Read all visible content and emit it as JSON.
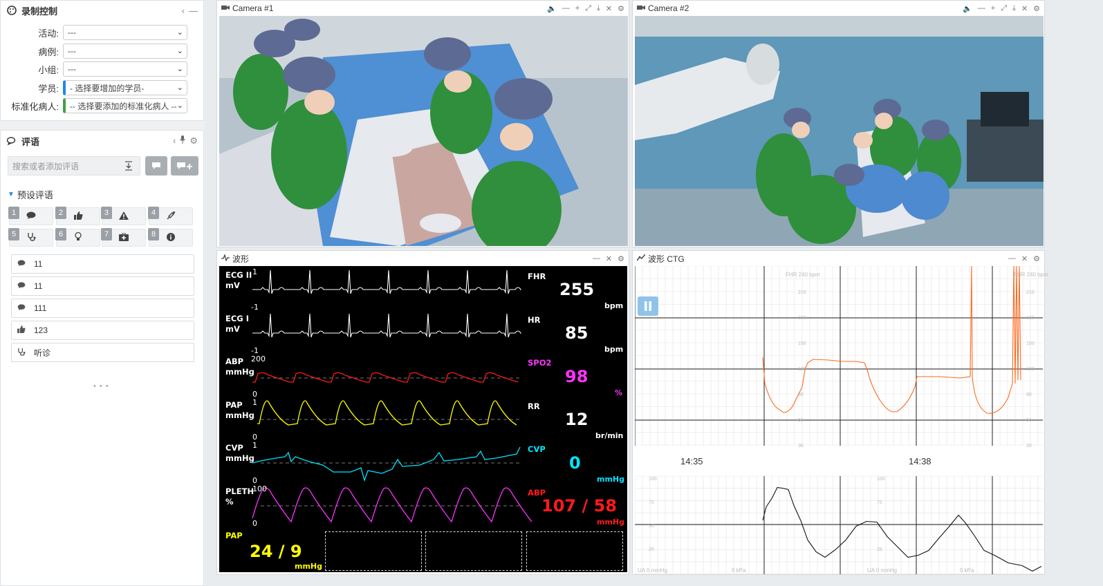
{
  "sidebar": {
    "record": {
      "title": "录制控制",
      "fields": [
        {
          "label": "活动:",
          "value": "---"
        },
        {
          "label": "病例:",
          "value": "---"
        },
        {
          "label": "小组:",
          "value": "---"
        },
        {
          "label": "学员:",
          "value": "- 选择要增加的学员-"
        },
        {
          "label": "标准化病人:",
          "value": "-- 选择要添加的标准化病人 --"
        }
      ]
    },
    "comments": {
      "title": "评语",
      "search_placeholder": "搜索或者添加评语",
      "preset_title": "预设评语",
      "presets": [
        {
          "num": "1",
          "icon": "comment-icon"
        },
        {
          "num": "2",
          "icon": "thumbs-up-icon"
        },
        {
          "num": "3",
          "icon": "warning-icon"
        },
        {
          "num": "4",
          "icon": "syringe-icon"
        },
        {
          "num": "5",
          "icon": "stethoscope-icon"
        },
        {
          "num": "6",
          "icon": "lightbulb-icon"
        },
        {
          "num": "7",
          "icon": "medkit-icon"
        },
        {
          "num": "8",
          "icon": "info-icon"
        }
      ],
      "items": [
        {
          "icon": "comment-icon",
          "text": "11"
        },
        {
          "icon": "comment-icon",
          "text": "11"
        },
        {
          "icon": "comment-icon",
          "text": "111"
        },
        {
          "icon": "thumbs-up-icon",
          "text": "123"
        },
        {
          "icon": "stethoscope-icon",
          "text": "听诊"
        }
      ],
      "more": "• • •"
    }
  },
  "cameras": [
    {
      "title": "Camera #1"
    },
    {
      "title": "Camera #2"
    }
  ],
  "waveform": {
    "title": "波形",
    "channels": [
      {
        "label": "ECG II",
        "unit": "mV",
        "scale_top": "1",
        "scale_bot": "-1",
        "color": "#ffffff"
      },
      {
        "label": "ECG I",
        "unit": "mV",
        "scale_top": "",
        "scale_bot": "-1",
        "color": "#ffffff"
      },
      {
        "label": "ABP",
        "unit": "mmHg",
        "scale_top": "200",
        "scale_bot": "0",
        "color": "#ff1a1a"
      },
      {
        "label": "PAP",
        "unit": "mmHg",
        "scale_top": "1",
        "scale_bot": "0",
        "color": "#ffff00"
      },
      {
        "label": "CVP",
        "unit": "mmHg",
        "scale_top": "1",
        "scale_bot": "0",
        "color": "#00e5ff"
      },
      {
        "label": "PLETH",
        "unit": "%",
        "scale_top": "100",
        "scale_bot": "0",
        "color": "#ff33ff"
      }
    ],
    "vitals": [
      {
        "label": "FHR",
        "value": "255",
        "unit": "bpm",
        "color": "#ffffff"
      },
      {
        "label": "HR",
        "value": "85",
        "unit": "bpm",
        "color": "#ffffff"
      },
      {
        "label": "SPO2",
        "value": "98",
        "unit": "%",
        "color": "#ff33ff"
      },
      {
        "label": "RR",
        "value": "12",
        "unit": "br/min",
        "color": "#ffffff"
      },
      {
        "label": "CVP",
        "value": "0",
        "unit": "mmHg",
        "color": "#00e5ff"
      },
      {
        "label": "ABP",
        "value": "107 / 58",
        "unit": "mmHg",
        "color": "#ff1a1a"
      }
    ],
    "pap": {
      "label": "PAP",
      "value": "24 / 9",
      "unit": "mmHg",
      "color": "#ffff00"
    }
  },
  "ctg": {
    "title": "波形 CTG",
    "time_labels": [
      "14:35",
      "14:38"
    ],
    "fhr_header": "FHR 240 bpm",
    "fhr_ticks": [
      "210",
      "180",
      "150",
      "120",
      "90",
      "60",
      "30"
    ],
    "ua_ticks": [
      "100",
      "75",
      "50",
      "25"
    ],
    "ua_footer": "UA 0 mmHg",
    "kpa_footer": "0 kPa",
    "fhr_line_color": "#ff6a1f"
  }
}
